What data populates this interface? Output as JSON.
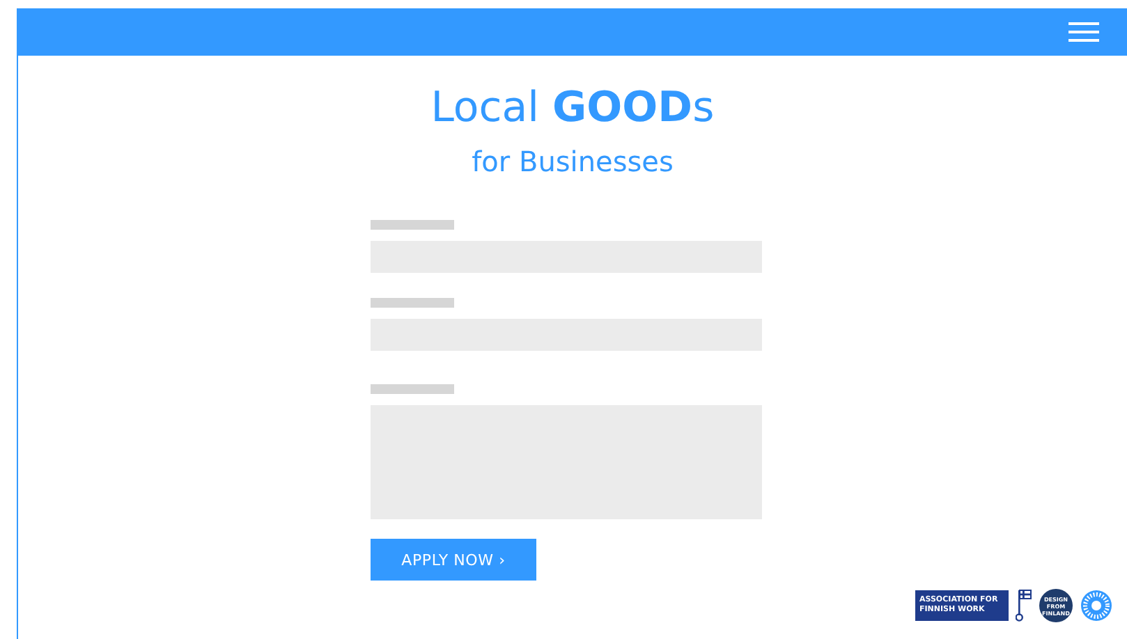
{
  "hero": {
    "title": "Local **GOOD**s",
    "subtitle": "for Businesses"
  },
  "form": {
    "fields": [
      {
        "kind": "input"
      },
      {
        "kind": "input"
      },
      {
        "kind": "textarea"
      }
    ],
    "button": "APPLY NOW ›"
  },
  "footer_logos": {
    "association": "ASSOCIATION FOR FINNISH WORK",
    "design_badge": "DESIGN FROM FINLAND"
  }
}
